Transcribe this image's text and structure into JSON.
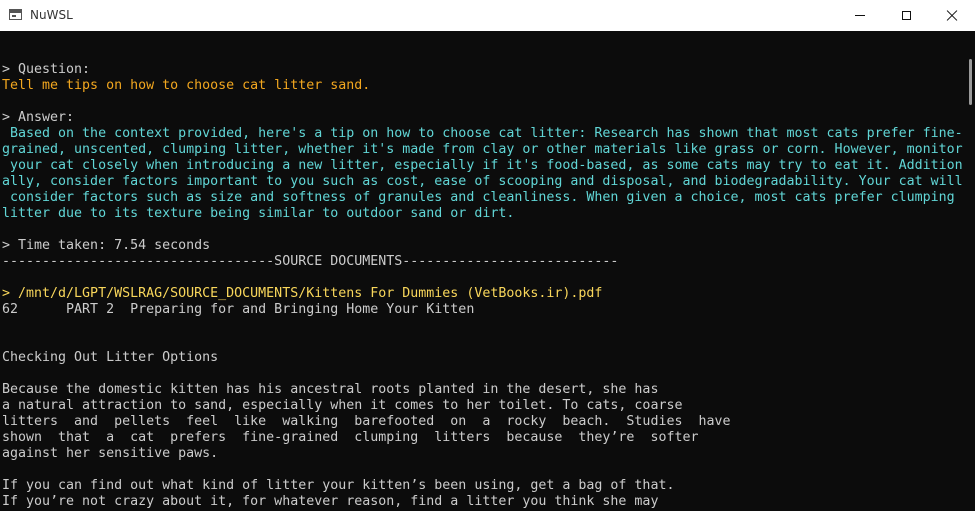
{
  "window": {
    "title": "NuWSL",
    "app_icon": "terminal-window-icon",
    "controls": {
      "minimize": "minimize-icon",
      "maximize": "maximize-icon",
      "close": "close-icon"
    }
  },
  "colors": {
    "background": "#0c0c0c",
    "default_text": "#cccccc",
    "question_text": "#f2a71f",
    "answer_text": "#61d6d6",
    "source_path": "#f9d75b"
  },
  "terminal": {
    "question_prompt": "> Question:",
    "question_text": "Tell me tips on how to choose cat litter sand.",
    "answer_prompt": "> Answer:",
    "answer_lines": [
      " Based on the context provided, here's a tip on how to choose cat litter: Research has shown that most cats prefer fine-",
      "grained, unscented, clumping litter, whether it's made from clay or other materials like grass or corn. However, monitor",
      " your cat closely when introducing a new litter, especially if it's food-based, as some cats may try to eat it. Addition",
      "ally, consider factors important to you such as cost, ease of scooping and disposal, and biodegradability. Your cat will",
      " consider factors such as size and softness of granules and cleanliness. When given a choice, most cats prefer clumping",
      "litter due to its texture being similar to outdoor sand or dirt."
    ],
    "time_taken": "> Time taken: 7.54 seconds",
    "source_divider": "----------------------------------SOURCE DOCUMENTS---------------------------",
    "source_path": "> /mnt/d/LGPT/WSLRAG/SOURCE_DOCUMENTS/Kittens For Dummies (VetBooks.ir).pdf",
    "page_header": "62      PART 2  Preparing for and Bringing Home Your Kitten",
    "section_heading": "Checking Out Litter Options",
    "paragraph_1": [
      "Because the domestic kitten has his ancestral roots planted in the desert, she has",
      "a natural attraction to sand, especially when it comes to her toilet. To cats, coarse",
      "litters  and  pellets  feel  like  walking  barefooted  on  a  rocky  beach.  Studies  have",
      "shown  that  a  cat  prefers  fine-grained  clumping  litters  because  they’re  softer",
      "against her sensitive paws."
    ],
    "paragraph_2": [
      "If you can find out what kind of litter your kitten’s been using, get a bag of that.",
      "If you’re not crazy about it, for whatever reason, find a litter you think she may"
    ]
  }
}
